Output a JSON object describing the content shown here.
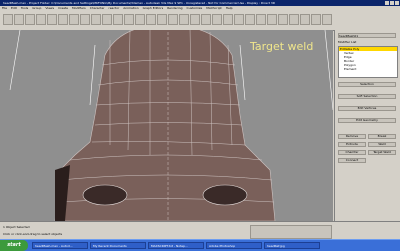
{
  "window": {
    "title": "headMesh.max    - Project Folder: C:\\Documents and Settings\\MKFONG\\My Documents\\3dsmax    - Autodesk 3ds Max 9 SP1    - Unregistered - Not for Commercial Use    - Display : Direct 3D"
  },
  "menubar": {
    "items": [
      "File",
      "Edit",
      "Tools",
      "Group",
      "Views",
      "Create",
      "Modifiers",
      "Character",
      "reactor",
      "Animation",
      "Graph Editors",
      "Rendering",
      "Customize",
      "MAXScript",
      "Help"
    ]
  },
  "viewport": {
    "annotation": "Target weld",
    "annotation_color": "#f0e68c",
    "background": "#8f8f8f",
    "mesh_color": "#7a605a"
  },
  "command_panel": {
    "object_name": "headMesh01",
    "modifier_list": "Modifier List",
    "stack": [
      "Editable Poly",
      "Vertex",
      "Edge",
      "Border",
      "Polygon",
      "Element"
    ],
    "selected_stack_item": "Editable Poly",
    "sections": [
      "Selection",
      "Soft Selection",
      "Edit Vertices",
      "Edit Geometry"
    ],
    "buttons": [
      "Remove",
      "Break",
      "Extrude",
      "Weld",
      "Chamfer",
      "Target Weld",
      "Connect"
    ]
  },
  "statusbar": {
    "selection": "1 Object Selected",
    "prompt": "Click or click-and-drag to select objects"
  },
  "taskbar": {
    "start_label": "start",
    "tasks": [
      "headMesh.max - Autod...",
      "My Recent Documents",
      "MAXSCRIPT.txt - Notep...",
      "Adobe Photoshop",
      "headRef.jpg"
    ],
    "clock": ""
  }
}
